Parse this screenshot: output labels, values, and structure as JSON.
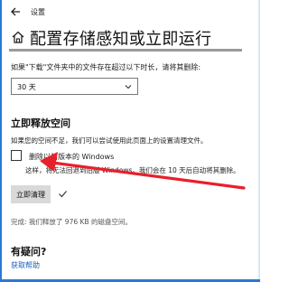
{
  "window": {
    "title": "设置"
  },
  "page": {
    "title": "配置存储感知或立即运行"
  },
  "downloads": {
    "label": "如果\"下载\"文件夹中的文件存在超过以下时长，请将其删除:",
    "selected": "30 天"
  },
  "free_space": {
    "heading": "立即释放空间",
    "info": "如果您的空间不足，我们可以尝试使用此页面上的设置清理文件。",
    "checkbox_label": "删除以前版本的 Windows",
    "checkbox_checked": false,
    "warning": "这样，将无法回退到旧版 Windows。我们会在 10 天后自动将其删除。",
    "button_label": "立即清理",
    "status": "完成: 我们释放了 976 KB 的磁盘空间。"
  },
  "help": {
    "heading": "有疑问?",
    "link": "获取帮助"
  },
  "colors": {
    "accent": "#2b79d6",
    "link": "#1a5fb4",
    "annotation_arrow": "#e8202a"
  }
}
